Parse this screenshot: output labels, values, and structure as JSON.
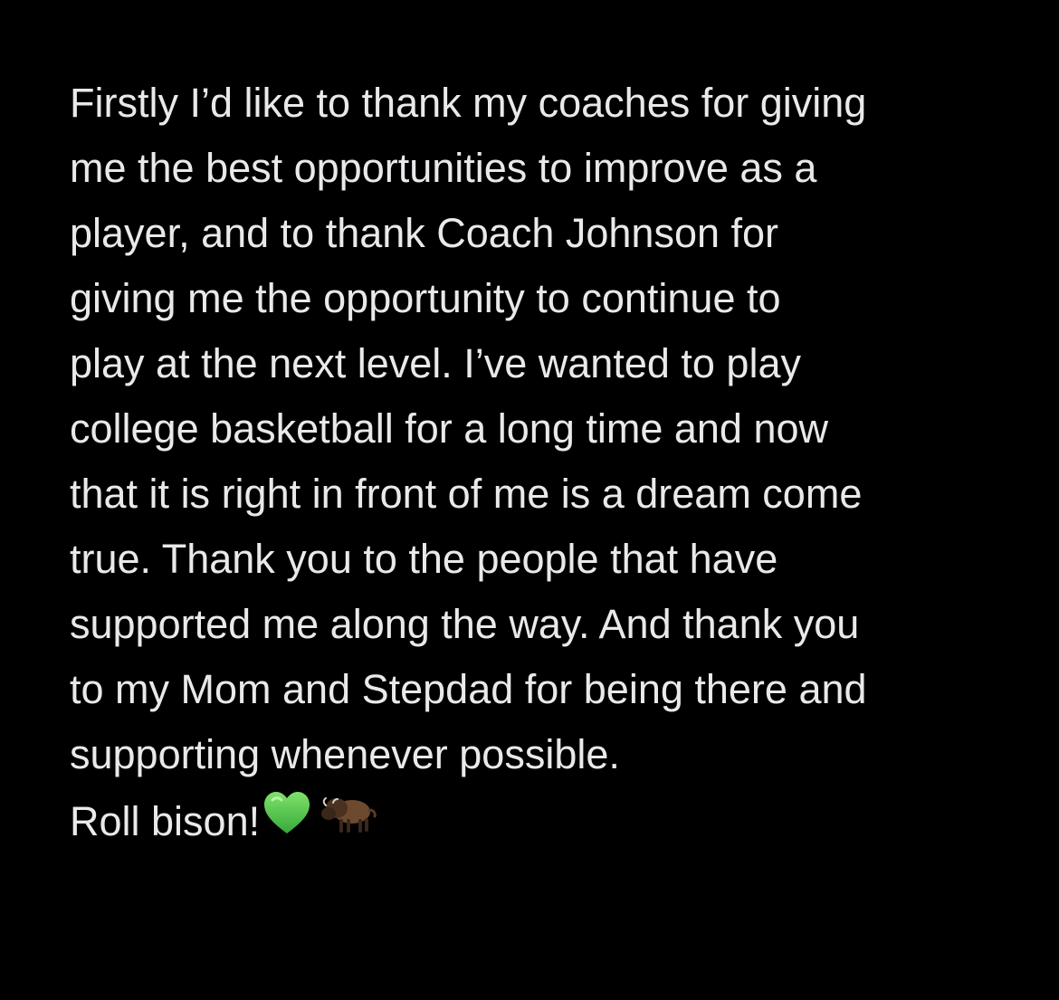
{
  "note": {
    "lines": [
      "Firstly I’d like to thank my coaches for giving",
      "me the best opportunities to improve as a",
      "player, and to thank Coach Johnson for",
      "giving me the opportunity to continue to",
      "play at the next level. I’ve wanted to play",
      "college basketball for a long time and now",
      "that it is right in front of me is a dream come",
      "true. Thank you to the people that have",
      "supported me along the way. And thank you",
      "to my Mom and Stepdad for being there and",
      "supporting whenever possible."
    ],
    "sign_off": "Roll bison!",
    "emojis": [
      "green-heart-icon",
      "bison-icon"
    ]
  },
  "colors": {
    "background": "#000000",
    "text": "#e9e9eb",
    "heart": "#58c84a"
  }
}
